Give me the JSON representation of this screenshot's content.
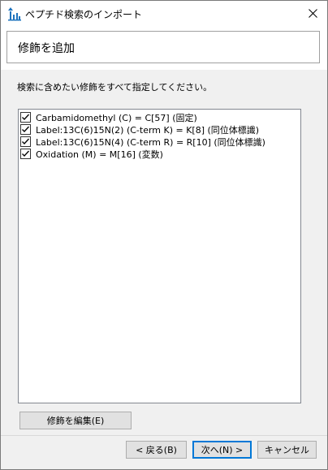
{
  "window": {
    "title": "ペプチド検索のインポート",
    "icon": "app-chart-icon"
  },
  "header": {
    "title": "修飾を追加"
  },
  "instruction": "検索に含めたい修飾をすべて指定してください。",
  "modifications": [
    {
      "label": "Carbamidomethyl (C) = C[57] (固定)",
      "checked": true
    },
    {
      "label": "Label:13C(6)15N(2) (C-term K) = K[8] (同位体標識)",
      "checked": true
    },
    {
      "label": "Label:13C(6)15N(4) (C-term R) = R[10] (同位体標識)",
      "checked": true
    },
    {
      "label": "Oxidation (M) = M[16] (変数)",
      "checked": true
    }
  ],
  "buttons": {
    "edit": "修飾を編集(E)",
    "back": "< 戻る(B)",
    "next": "次へ(N) >",
    "cancel": "キャンセル"
  },
  "colors": {
    "accent": "#0078d7",
    "icon_blue": "#1e73be"
  }
}
